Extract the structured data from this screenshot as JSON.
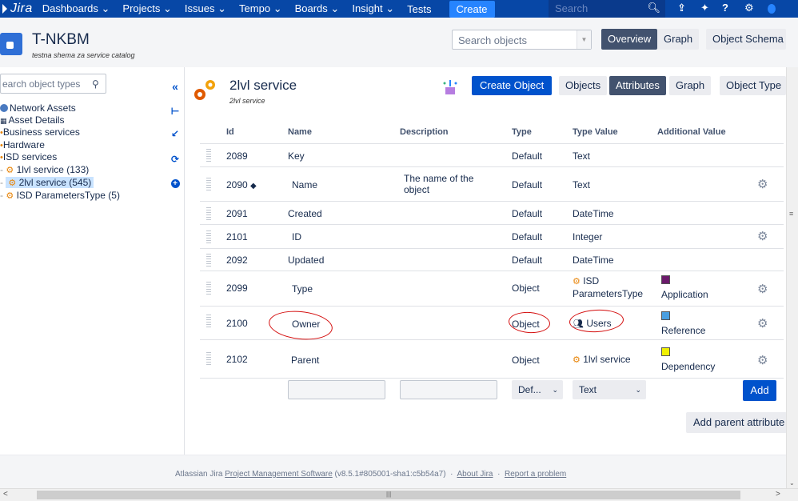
{
  "topnav": {
    "logo": "Jira",
    "items": [
      "Dashboards ⌵",
      "Projects ⌵",
      "Issues ⌵",
      "Tempo ⌵",
      "Boards ⌵",
      "Insight ⌵",
      "Tests"
    ],
    "items_text": [
      "Dashboards",
      "Projects",
      "Issues",
      "Tempo",
      "Boards",
      "Insight",
      "Tests"
    ],
    "create": "Create",
    "search_placeholder": "Search"
  },
  "header": {
    "project_title": "T-NKBM",
    "project_subtitle": "testna shema za service catalog",
    "search_placeholder": "Search objects",
    "tabs": [
      "Overview",
      "Graph",
      "Object Schema"
    ]
  },
  "sidebar": {
    "search_placeholder": "earch object types",
    "tree": [
      {
        "label": "Network Assets"
      },
      {
        "label": "Asset Details"
      },
      {
        "label": "Business services"
      },
      {
        "label": "Hardware"
      },
      {
        "label": "ISD services"
      },
      {
        "label": "1lvl service (133)"
      },
      {
        "label": "2lvl service (545)"
      },
      {
        "label": "ISD ParametersType (5)"
      }
    ]
  },
  "object_type": {
    "title": "2lvl service",
    "subtitle": "2lvl service",
    "create_button": "Create Object",
    "tabs": [
      "Objects",
      "Attributes",
      "Graph",
      "Object Type"
    ]
  },
  "table": {
    "headers": [
      "Id",
      "Name",
      "Description",
      "Type",
      "Type Value",
      "Additional Value"
    ],
    "rows": [
      {
        "id": "2089",
        "name": "Key",
        "description": "",
        "type": "Default",
        "type_value": "Text",
        "additional": ""
      },
      {
        "id": "2090",
        "name": "Name",
        "description": "The name of the object",
        "description_l1": "The name of the",
        "description_l2": "object",
        "type": "Default",
        "type_value": "Text",
        "additional": ""
      },
      {
        "id": "2091",
        "name": "Created",
        "description": "",
        "type": "Default",
        "type_value": "DateTime",
        "additional": ""
      },
      {
        "id": "2101",
        "name": "ID",
        "description": "",
        "type": "Default",
        "type_value": "Integer",
        "additional": ""
      },
      {
        "id": "2092",
        "name": "Updated",
        "description": "",
        "type": "Default",
        "type_value": "DateTime",
        "additional": ""
      },
      {
        "id": "2099",
        "name": "Type",
        "description": "",
        "type": "Object",
        "type_value": "ISD ParametersType",
        "type_value_l1": "ISD",
        "type_value_l2": "ParametersType",
        "additional": "Application",
        "swatch_color": "#6b1a6b"
      },
      {
        "id": "2100",
        "name": "Owner",
        "description": "",
        "type": "Object",
        "type_value": "Users",
        "additional": "Reference",
        "swatch_color": "#4a9fe0"
      },
      {
        "id": "2102",
        "name": "Parent",
        "description": "",
        "type": "Object",
        "type_value": "1lvl service",
        "additional": "Dependency",
        "swatch_color": "#f0f000"
      }
    ],
    "new_row": {
      "type_select": "Def...",
      "type_value_select": "Text"
    },
    "add_button": "Add",
    "add_parent_button": "Add parent attribute"
  },
  "footer": {
    "prefix": "Atlassian Jira ",
    "link1": "Project Management Software",
    "version": " (v8.5.1#805001-sha1:c5b54a7)",
    "sep1": "·",
    "link2": "About Jira",
    "sep2": "·",
    "link3": "Report a problem"
  },
  "colors": {
    "nav": "#0747a6",
    "primary": "#0052cc",
    "annotation": "#d40d0d"
  }
}
